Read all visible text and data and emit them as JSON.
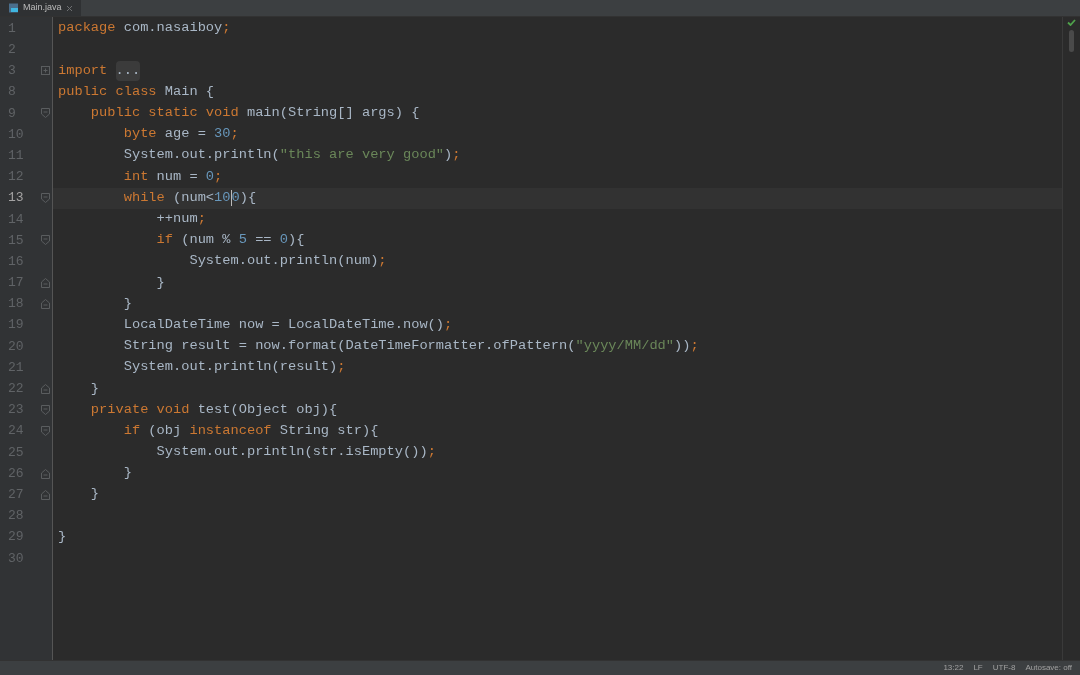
{
  "tabs": [
    {
      "label": "Main.java",
      "selected": true
    }
  ],
  "editor": {
    "lines": [
      {
        "number": "1",
        "kind": "plain",
        "current": false,
        "tokens": [
          {
            "kind": "kw",
            "text": "package"
          },
          {
            "kind": "plain",
            "text": " com.nasaiboy"
          },
          {
            "kind": "kw",
            "text": ";"
          }
        ]
      },
      {
        "number": "2",
        "kind": "plain",
        "current": false
      },
      {
        "number": "3",
        "kind": "collapsed",
        "current": false,
        "tokens": [
          {
            "kind": "kw",
            "text": "import "
          },
          {
            "kind": "folded",
            "text": "..."
          }
        ]
      },
      {
        "number": "8",
        "kind": "plain",
        "current": false,
        "tokens": [
          {
            "kind": "kw",
            "text": "public class"
          },
          {
            "kind": "plain",
            "text": " Main {"
          }
        ]
      },
      {
        "number": "9",
        "kind": "opener",
        "current": false,
        "tokens": [
          {
            "kind": "kw",
            "text": "    public static void"
          },
          {
            "kind": "plain",
            "text": " main(String[] args) {"
          }
        ]
      },
      {
        "number": "10",
        "kind": "plain",
        "current": false,
        "tokens": [
          {
            "kind": "kw",
            "text": "        byte"
          },
          {
            "kind": "plain",
            "text": " age = "
          },
          {
            "kind": "num",
            "text": "30"
          },
          {
            "kind": "kw",
            "text": ";"
          }
        ]
      },
      {
        "number": "11",
        "kind": "plain",
        "current": false,
        "tokens": [
          {
            "kind": "plain",
            "text": "        System.out.println("
          },
          {
            "kind": "str",
            "text": "\"this are very good\""
          },
          {
            "kind": "plain",
            "text": ")"
          },
          {
            "kind": "kw",
            "text": ";"
          }
        ]
      },
      {
        "number": "12",
        "kind": "plain",
        "current": false,
        "tokens": [
          {
            "kind": "kw",
            "text": "        int"
          },
          {
            "kind": "plain",
            "text": " num = "
          },
          {
            "kind": "num",
            "text": "0"
          },
          {
            "kind": "kw",
            "text": ";"
          }
        ]
      },
      {
        "number": "13",
        "kind": "opener",
        "current": true,
        "tokens": [
          {
            "kind": "kw",
            "text": "        while"
          },
          {
            "kind": "plain",
            "text": " (num<"
          },
          {
            "kind": "num",
            "text": "10"
          },
          {
            "kind": "caret"
          },
          {
            "kind": "num",
            "text": "0"
          },
          {
            "kind": "plain",
            "text": "){"
          }
        ]
      },
      {
        "number": "14",
        "kind": "plain",
        "current": false,
        "tokens": [
          {
            "kind": "plain",
            "text": "            ++num"
          },
          {
            "kind": "kw",
            "text": ";"
          }
        ]
      },
      {
        "number": "15",
        "kind": "opener",
        "current": false,
        "tokens": [
          {
            "kind": "kw",
            "text": "            if"
          },
          {
            "kind": "plain",
            "text": " (num % "
          },
          {
            "kind": "num",
            "text": "5"
          },
          {
            "kind": "plain",
            "text": " == "
          },
          {
            "kind": "num",
            "text": "0"
          },
          {
            "kind": "plain",
            "text": "){"
          }
        ]
      },
      {
        "number": "16",
        "kind": "plain",
        "current": false,
        "tokens": [
          {
            "kind": "plain",
            "text": "                System.out.println(num)"
          },
          {
            "kind": "kw",
            "text": ";"
          }
        ]
      },
      {
        "number": "17",
        "kind": "closer",
        "current": false,
        "tokens": [
          {
            "kind": "plain",
            "text": "            }"
          }
        ]
      },
      {
        "number": "18",
        "kind": "closer",
        "current": false,
        "tokens": [
          {
            "kind": "plain",
            "text": "        }"
          }
        ]
      },
      {
        "number": "19",
        "kind": "plain",
        "current": false,
        "tokens": [
          {
            "kind": "plain",
            "text": "        LocalDateTime now = LocalDateTime.now()"
          },
          {
            "kind": "kw",
            "text": ";"
          }
        ]
      },
      {
        "number": "20",
        "kind": "plain",
        "current": false,
        "tokens": [
          {
            "kind": "plain",
            "text": "        String result = now.format(DateTimeFormatter.ofPattern("
          },
          {
            "kind": "str",
            "text": "\"yyyy/MM/dd\""
          },
          {
            "kind": "plain",
            "text": "))"
          },
          {
            "kind": "kw",
            "text": ";"
          }
        ]
      },
      {
        "number": "21",
        "kind": "plain",
        "current": false,
        "tokens": [
          {
            "kind": "plain",
            "text": "        System.out.println(result)"
          },
          {
            "kind": "kw",
            "text": ";"
          }
        ]
      },
      {
        "number": "22",
        "kind": "closer",
        "current": false,
        "tokens": [
          {
            "kind": "plain",
            "text": "    }"
          }
        ]
      },
      {
        "number": "23",
        "kind": "opener",
        "current": false,
        "tokens": [
          {
            "kind": "kw",
            "text": "    private void"
          },
          {
            "kind": "plain",
            "text": " test(Object obj){"
          }
        ]
      },
      {
        "number": "24",
        "kind": "opener",
        "current": false,
        "tokens": [
          {
            "kind": "kw",
            "text": "        if"
          },
          {
            "kind": "plain",
            "text": " (obj "
          },
          {
            "kind": "kw",
            "text": "instanceof"
          },
          {
            "kind": "plain",
            "text": " String str){"
          }
        ]
      },
      {
        "number": "25",
        "kind": "plain",
        "current": false,
        "tokens": [
          {
            "kind": "plain",
            "text": "            System.out.println(str.isEmpty())"
          },
          {
            "kind": "kw",
            "text": ";"
          }
        ]
      },
      {
        "number": "26",
        "kind": "closer",
        "current": false,
        "tokens": [
          {
            "kind": "plain",
            "text": "        }"
          }
        ]
      },
      {
        "number": "27",
        "kind": "closer",
        "current": false,
        "tokens": [
          {
            "kind": "plain",
            "text": "    }"
          }
        ]
      },
      {
        "number": "28",
        "kind": "plain",
        "current": false
      },
      {
        "number": "29",
        "kind": "plain",
        "current": false,
        "tokens": [
          {
            "kind": "plain",
            "text": "}"
          }
        ]
      },
      {
        "number": "30",
        "kind": "plain",
        "current": false
      }
    ]
  },
  "status_bar": [
    "13:22",
    "LF",
    "UTF-8",
    "Autosave: off"
  ]
}
